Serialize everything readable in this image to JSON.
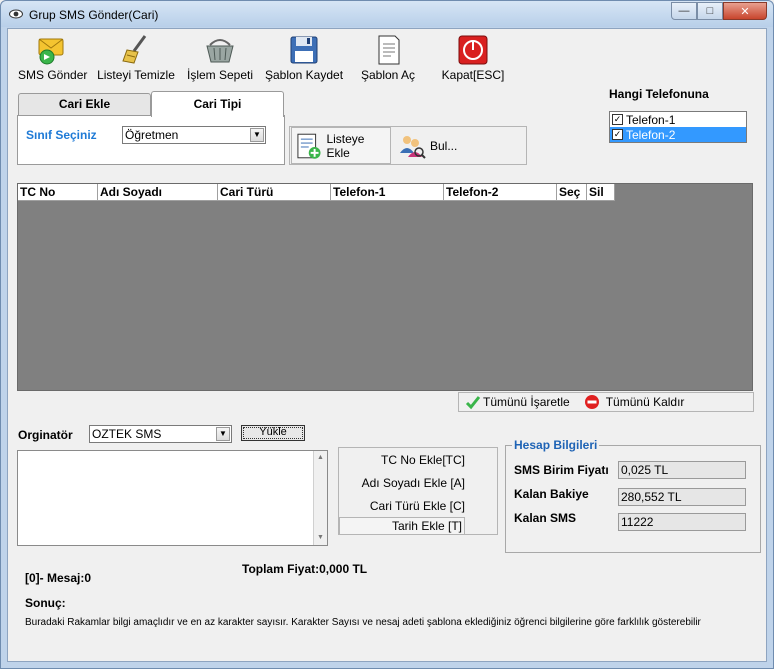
{
  "window": {
    "title": "Grup SMS Gönder(Cari)"
  },
  "toolbar": {
    "items": [
      {
        "label": "SMS Gönder",
        "icon": "sms-send-icon"
      },
      {
        "label": "Listeyi Temizle",
        "icon": "broom-icon"
      },
      {
        "label": "İşlem Sepeti",
        "icon": "basket-icon"
      },
      {
        "label": "Şablon Kaydet",
        "icon": "floppy-disk-icon"
      },
      {
        "label": "Şablon Aç",
        "icon": "open-document-icon"
      },
      {
        "label": "Kapat[ESC]",
        "icon": "power-icon"
      }
    ]
  },
  "tabs": [
    {
      "label": "Cari Ekle"
    },
    {
      "label": "Cari Tipi"
    }
  ],
  "cari_tipi": {
    "sinif_label": "Sınıf Seçiniz",
    "sinif_value": "Öğretmen"
  },
  "actions": {
    "liste_ekle": "Listeye Ekle",
    "bul": "Bul..."
  },
  "hangi_telefonuna": {
    "label": "Hangi Telefonuna",
    "options": [
      {
        "label": "Telefon-1",
        "checked": true,
        "selected": false
      },
      {
        "label": "Telefon-2",
        "checked": true,
        "selected": true
      }
    ]
  },
  "grid": {
    "columns": [
      "TC No",
      "Adı Soyadı",
      "Cari Türü",
      "Telefon-1",
      "Telefon-2",
      "Seç",
      "Sil"
    ]
  },
  "check_bar": {
    "select_all": "Tümünü İşaretle",
    "clear_all": "Tümünü Kaldır"
  },
  "orginator": {
    "label": "Orginatör",
    "value": "OZTEK SMS",
    "load_button": "Yükle"
  },
  "message": {
    "value": ""
  },
  "ekle_buttons": [
    "TC No Ekle[TC]",
    "Adı Soyadı Ekle [A]",
    "Cari Türü Ekle [C]",
    "Tarih Ekle [T]"
  ],
  "hesap": {
    "title": "Hesap Bilgileri",
    "rows": [
      {
        "label": "SMS Birim Fiyatı",
        "value": "0,025 TL"
      },
      {
        "label": "Kalan Bakiye",
        "value": "280,552 TL"
      },
      {
        "label": "Kalan SMS",
        "value": "11222"
      }
    ]
  },
  "footer": {
    "toplam": "Toplam Fiyat:0,000 TL",
    "mesaj": "[0]- Mesaj:0",
    "sonuc": "Sonuç:",
    "info": "Buradaki Rakamlar bilgi amaçlıdır ve en az karakter sayısır. Karakter Sayısı ve nesaj adeti şablona eklediğiniz öğrenci bilgilerine göre farklılık gösterebilir"
  }
}
